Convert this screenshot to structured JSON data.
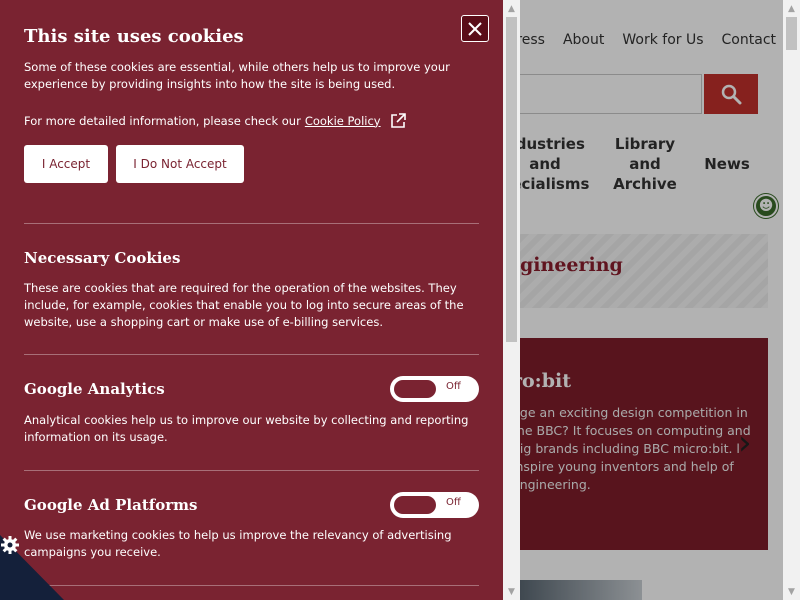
{
  "background": {
    "topnav": [
      "ress",
      "About",
      "Work for Us",
      "Contact"
    ],
    "nav_items": [
      {
        "label": "ndustries\nand\npecialisms"
      },
      {
        "label": "Library\nand\nArchive"
      },
      {
        "label": "News"
      }
    ],
    "banner_title": "gineering",
    "promo": {
      "title": "ro:bit",
      "text": "dge an exciting design competition in the BBC? It focuses on computing and pig brands including BBC micro:bit. l inspire young inventors and help of engineering."
    },
    "icons": {
      "search": "search-icon",
      "accessibility": "accessibility-icon",
      "next": "chevron-right-icon"
    }
  },
  "cookie_panel": {
    "title": "This site uses cookies",
    "intro": "Some of these cookies are essential, while others help us to improve your experience by providing insights into how the site is being used.",
    "more_info_text": "For more detailed information, please check our",
    "policy_link": "Cookie Policy",
    "accept_label": "I Accept",
    "reject_label": "I Do Not Accept",
    "sections": [
      {
        "title": "Necessary Cookies",
        "description": "These are cookies that are required for the operation of the websites. They include, for example, cookies that enable you to log into secure areas of the website, use a shopping cart or make use of e-billing services."
      },
      {
        "title": "Google Analytics",
        "toggle": "Off",
        "description": "Analytical cookies help us to improve our website by collecting and reporting information on its usage."
      },
      {
        "title": "Google Ad Platforms",
        "toggle": "Off",
        "description": "We use marketing cookies to help us improve the relevancy of advertising campaigns you receive."
      }
    ],
    "colors": {
      "panel": "#7a2331",
      "corner": "#14203a"
    }
  }
}
